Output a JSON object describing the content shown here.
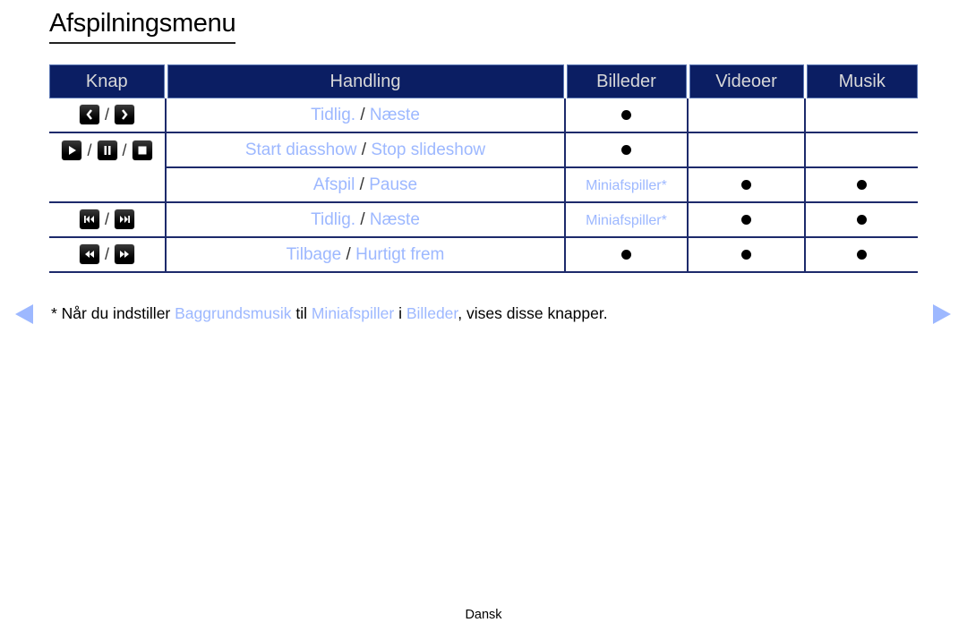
{
  "page": {
    "title": "Afspilningsmenu",
    "footer_language": "Dansk"
  },
  "colors": {
    "header_bg": "#0b1e63",
    "header_text": "#d8d8d8",
    "link": "#9db8ff",
    "border": "#1d2a6b",
    "nav_arrow": "#9db8ff"
  },
  "table": {
    "headers": [
      "Knap",
      "Handling",
      "Billeder",
      "Videoer",
      "Musik"
    ],
    "rows": [
      {
        "keys": [
          "prev-icon",
          "next-icon"
        ],
        "action_a": "Tidlig.",
        "action_sep": "/",
        "action_b": "Næste",
        "billeder": "•",
        "videoer": "",
        "musik": ""
      },
      {
        "keys": [
          "play-icon",
          "pause-icon",
          "stop-icon"
        ],
        "action_a": "Start diasshow",
        "action_sep": "/",
        "action_b": "Stop slideshow",
        "billeder": "•",
        "videoer": "",
        "musik": ""
      },
      {
        "keys": [],
        "action_a": "Afspil",
        "action_sep": "/",
        "action_b": "Pause",
        "billeder": "Miniafspiller*",
        "videoer": "•",
        "musik": "•"
      },
      {
        "keys": [
          "skip-back-icon",
          "skip-forward-icon"
        ],
        "action_a": "Tidlig.",
        "action_sep": "/",
        "action_b": "Næste",
        "billeder": "Miniafspiller*",
        "videoer": "•",
        "musik": "•"
      },
      {
        "keys": [
          "rewind-icon",
          "fast-forward-icon"
        ],
        "action_a": "Tilbage",
        "action_sep": "/",
        "action_b": "Hurtigt frem",
        "billeder": "•",
        "videoer": "•",
        "musik": "•"
      }
    ]
  },
  "note": {
    "prefix": "* Når du indstiller ",
    "link1": "Baggrundsmusik",
    "mid1": " til ",
    "link2": "Miniafspiller",
    "mid2": " i ",
    "link3": "Billeder",
    "suffix": ", vises disse knapper."
  },
  "navigation": {
    "prev_icon": "triangle-left-icon",
    "next_icon": "triangle-right-icon"
  }
}
